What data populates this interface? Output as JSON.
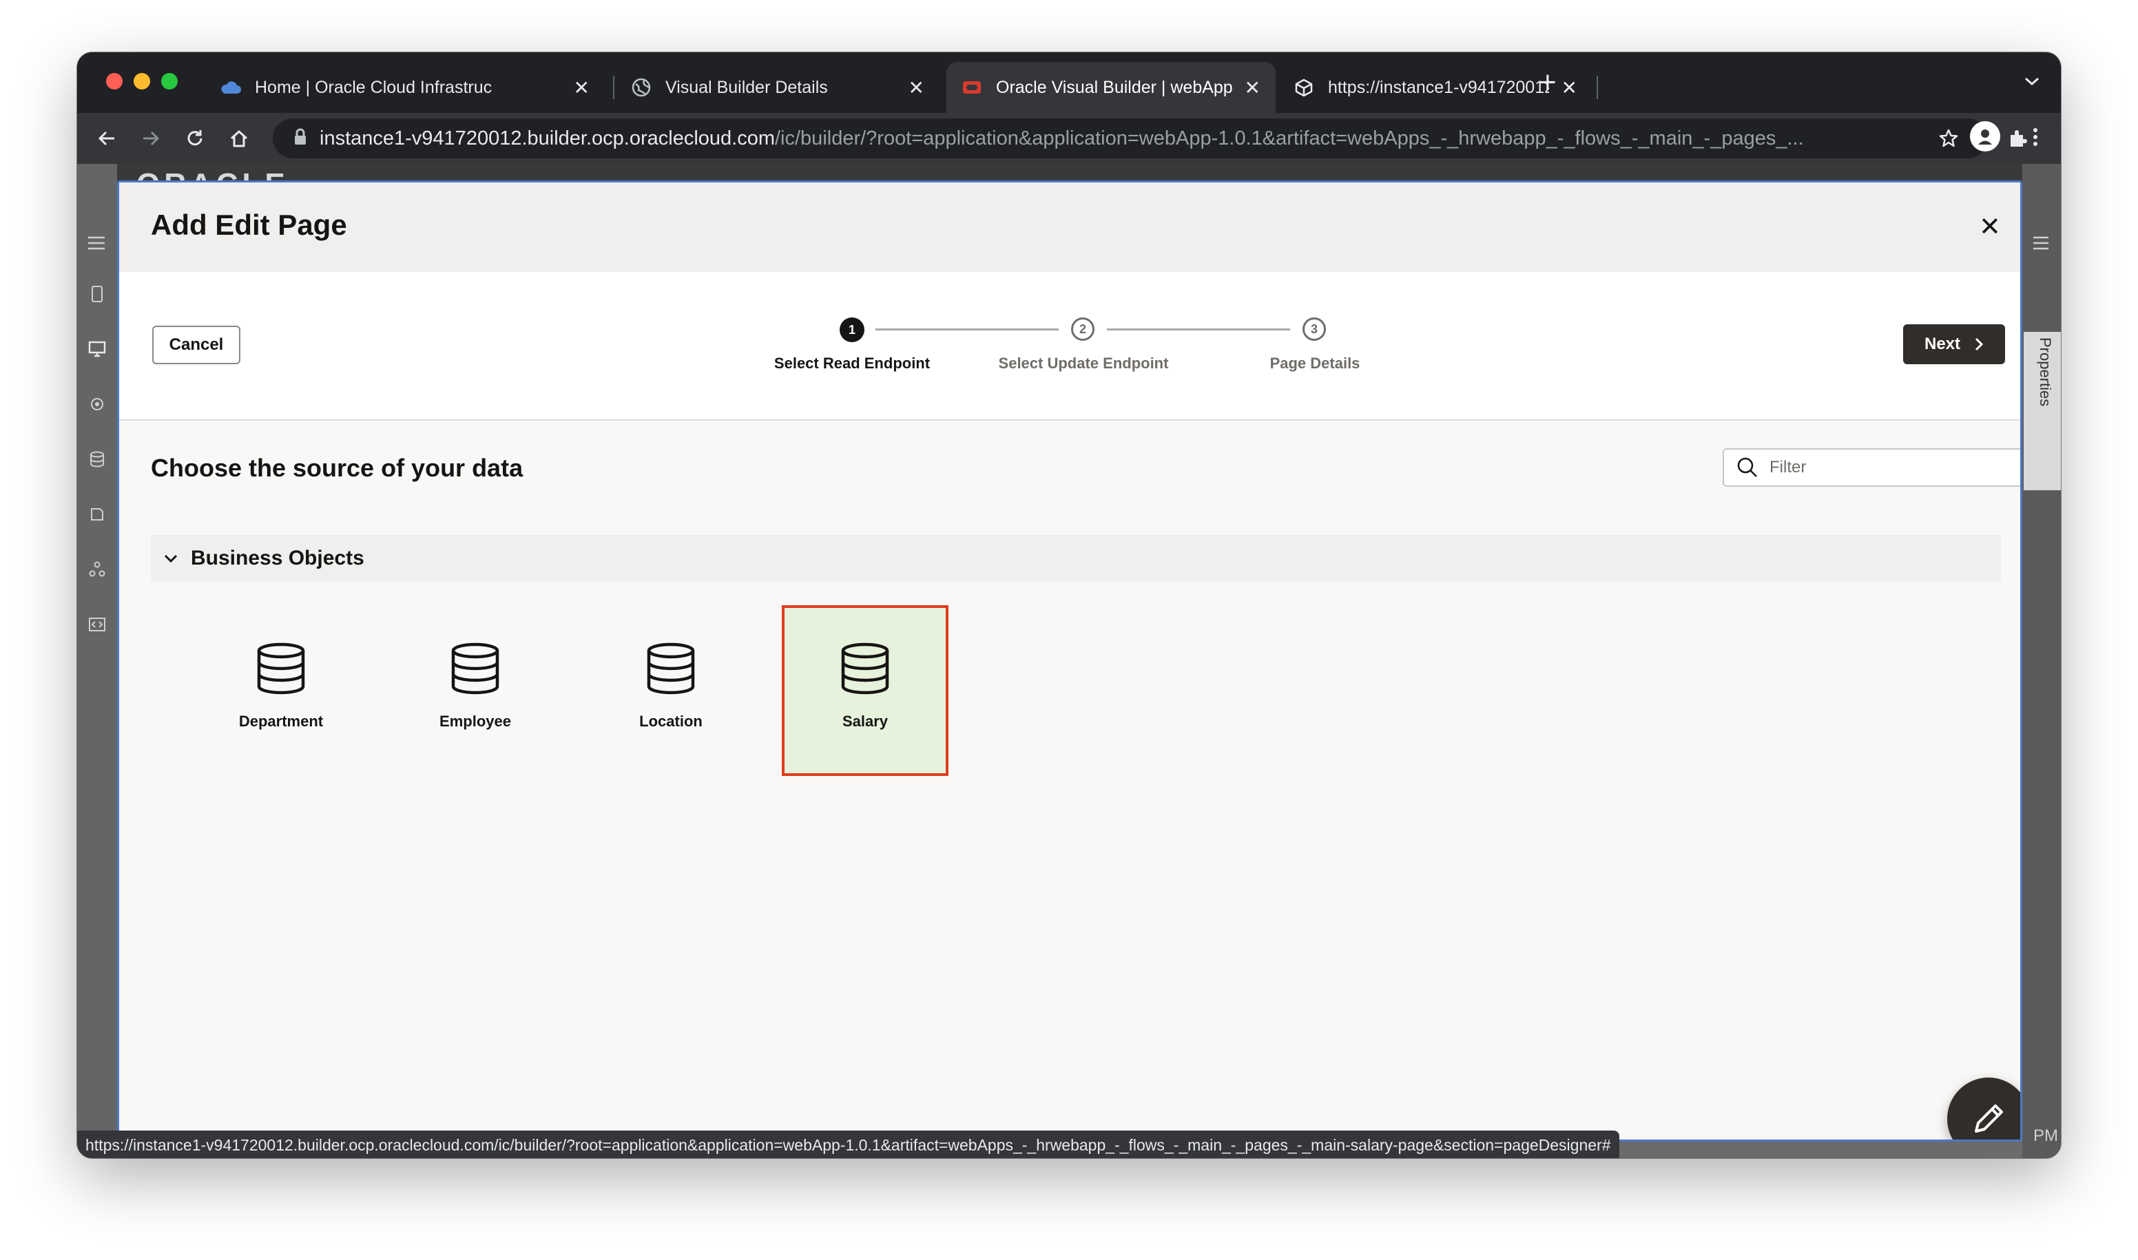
{
  "browser": {
    "tabs": [
      {
        "title": "Home | Oracle Cloud Infrastruc",
        "favicon": "cloud-icon",
        "active": false
      },
      {
        "title": "Visual Builder Details",
        "favicon": "globe-icon",
        "active": false
      },
      {
        "title": "Oracle Visual Builder | webApp",
        "favicon": "oracle-icon",
        "active": true
      },
      {
        "title": "https://instance1-v941720012.",
        "favicon": "cube-icon",
        "active": false
      }
    ],
    "url_host": "instance1-v941720012.builder.ocp.oraclecloud.com",
    "url_path": "/ic/builder/?root=application&application=webApp-1.0.1&artifact=webApps_-_hrwebapp_-_flows_-_main_-_pages_...",
    "status_url": "https://instance1-v941720012.builder.ocp.oraclecloud.com/ic/builder/?root=application&application=webApp-1.0.1&artifact=webApps_-_hrwebapp_-_flows_-_main_-_pages_-_main-salary-page&section=pageDesigner#"
  },
  "app": {
    "logo_text": "ORACLE",
    "properties_tab": "Properties",
    "clock_fragment": "PM"
  },
  "dialog": {
    "title": "Add Edit Page",
    "cancel_label": "Cancel",
    "next_label": "Next",
    "steps": [
      {
        "number": "1",
        "label": "Select Read Endpoint",
        "state": "current"
      },
      {
        "number": "2",
        "label": "Select Update Endpoint",
        "state": "todo"
      },
      {
        "number": "3",
        "label": "Page Details",
        "state": "todo"
      }
    ],
    "section_title": "Choose the source of your data",
    "filter_placeholder": "Filter",
    "group_label": "Business Objects",
    "tiles": [
      {
        "label": "Department",
        "selected": false
      },
      {
        "label": "Employee",
        "selected": false
      },
      {
        "label": "Location",
        "selected": false
      },
      {
        "label": "Salary",
        "selected": true
      }
    ]
  },
  "colors": {
    "selected_border": "#e03d1e",
    "selected_fill": "#e6f2dc",
    "dialog_focus_border": "#4a78c9",
    "dark_button": "#312d2a"
  }
}
